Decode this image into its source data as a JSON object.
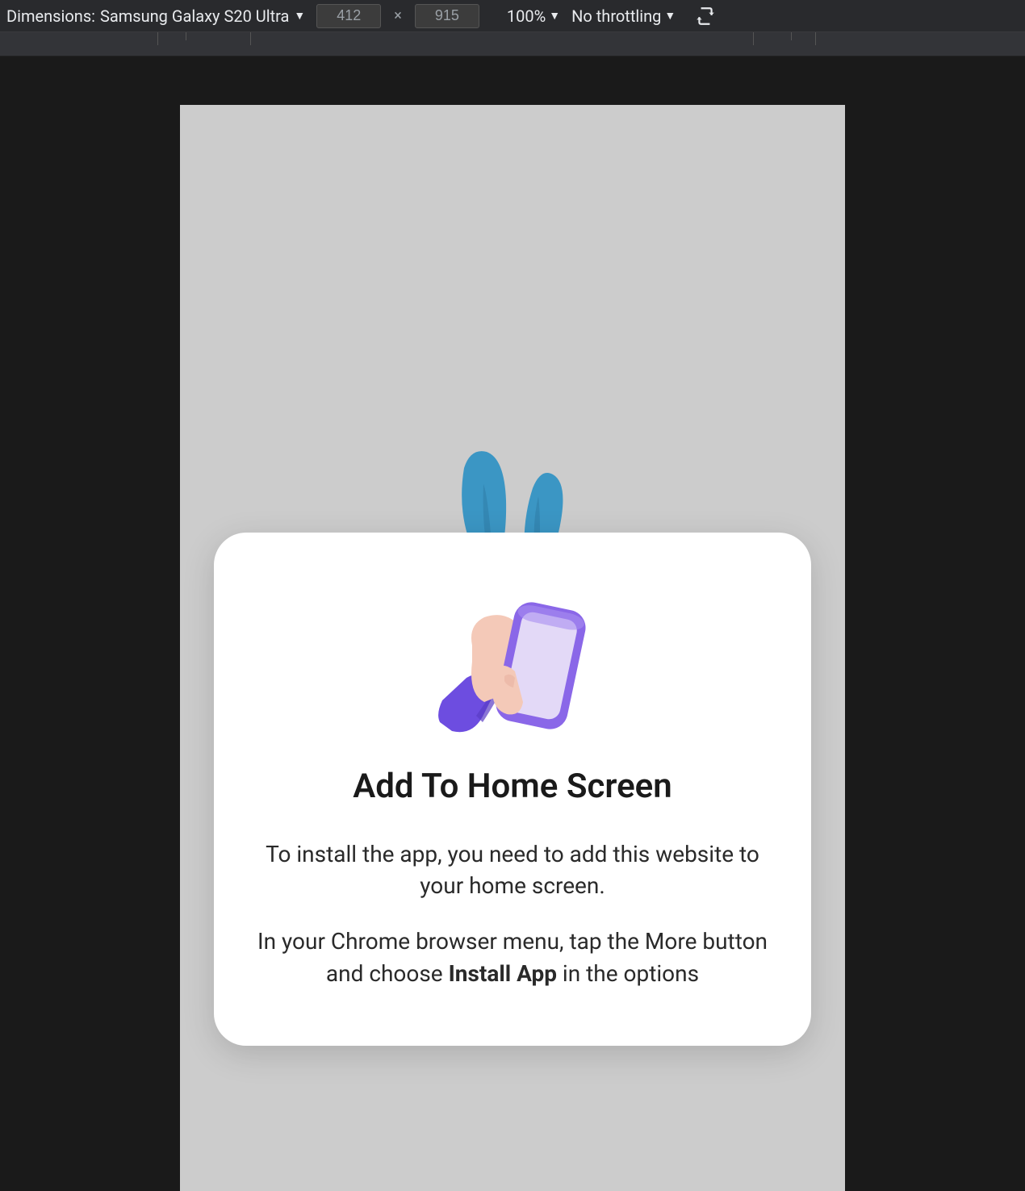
{
  "toolbar": {
    "dimensions_label": "Dimensions:",
    "device_name": "Samsung Galaxy S20 Ultra",
    "width": "412",
    "height": "915",
    "zoom": "100%",
    "throttling": "No throttling"
  },
  "modal": {
    "title": "Add To Home Screen",
    "text1": "To install the app, you need to add this website to your home screen.",
    "text2_before": "In your Chrome browser menu, tap the More button and choose ",
    "text2_bold": "Install App",
    "text2_after": " in the options",
    "icon_name": "hand-holding-phone-icon"
  },
  "background": {
    "logo_name": "bunny-ears-logo"
  }
}
